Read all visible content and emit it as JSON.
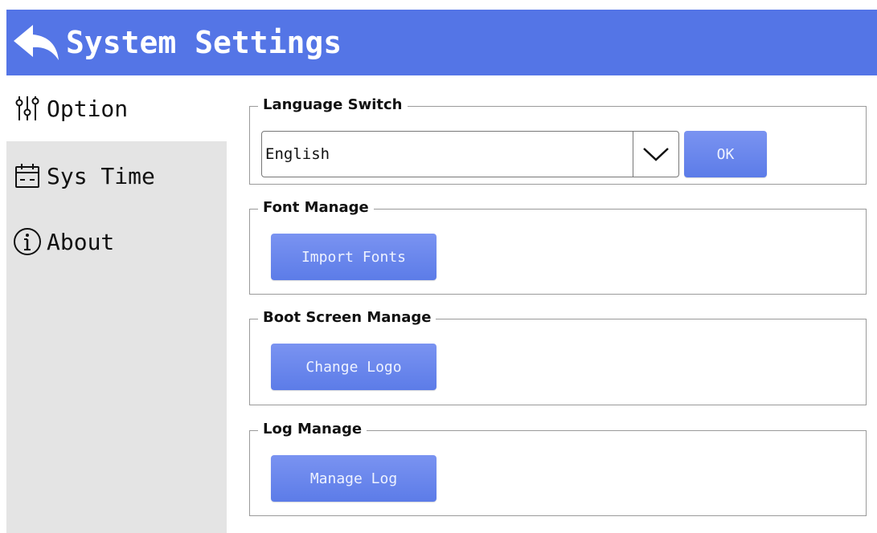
{
  "header": {
    "title": "System Settings",
    "back_icon": "back-arrow-icon",
    "background": "#5475e6"
  },
  "sidebar": {
    "items": [
      {
        "label": "Option",
        "icon": "sliders-icon",
        "active": true
      },
      {
        "label": "Sys Time",
        "icon": "calendar-icon",
        "active": false
      },
      {
        "label": "About",
        "icon": "info-icon",
        "active": false
      }
    ]
  },
  "language": {
    "legend": "Language Switch",
    "selected": "English",
    "ok_label": "OK"
  },
  "font": {
    "legend": "Font Manage",
    "button_label": "Import Fonts"
  },
  "boot": {
    "legend": "Boot Screen Manage",
    "button_label": "Change Logo"
  },
  "log": {
    "legend": "Log Manage",
    "button_label": "Manage Log"
  }
}
